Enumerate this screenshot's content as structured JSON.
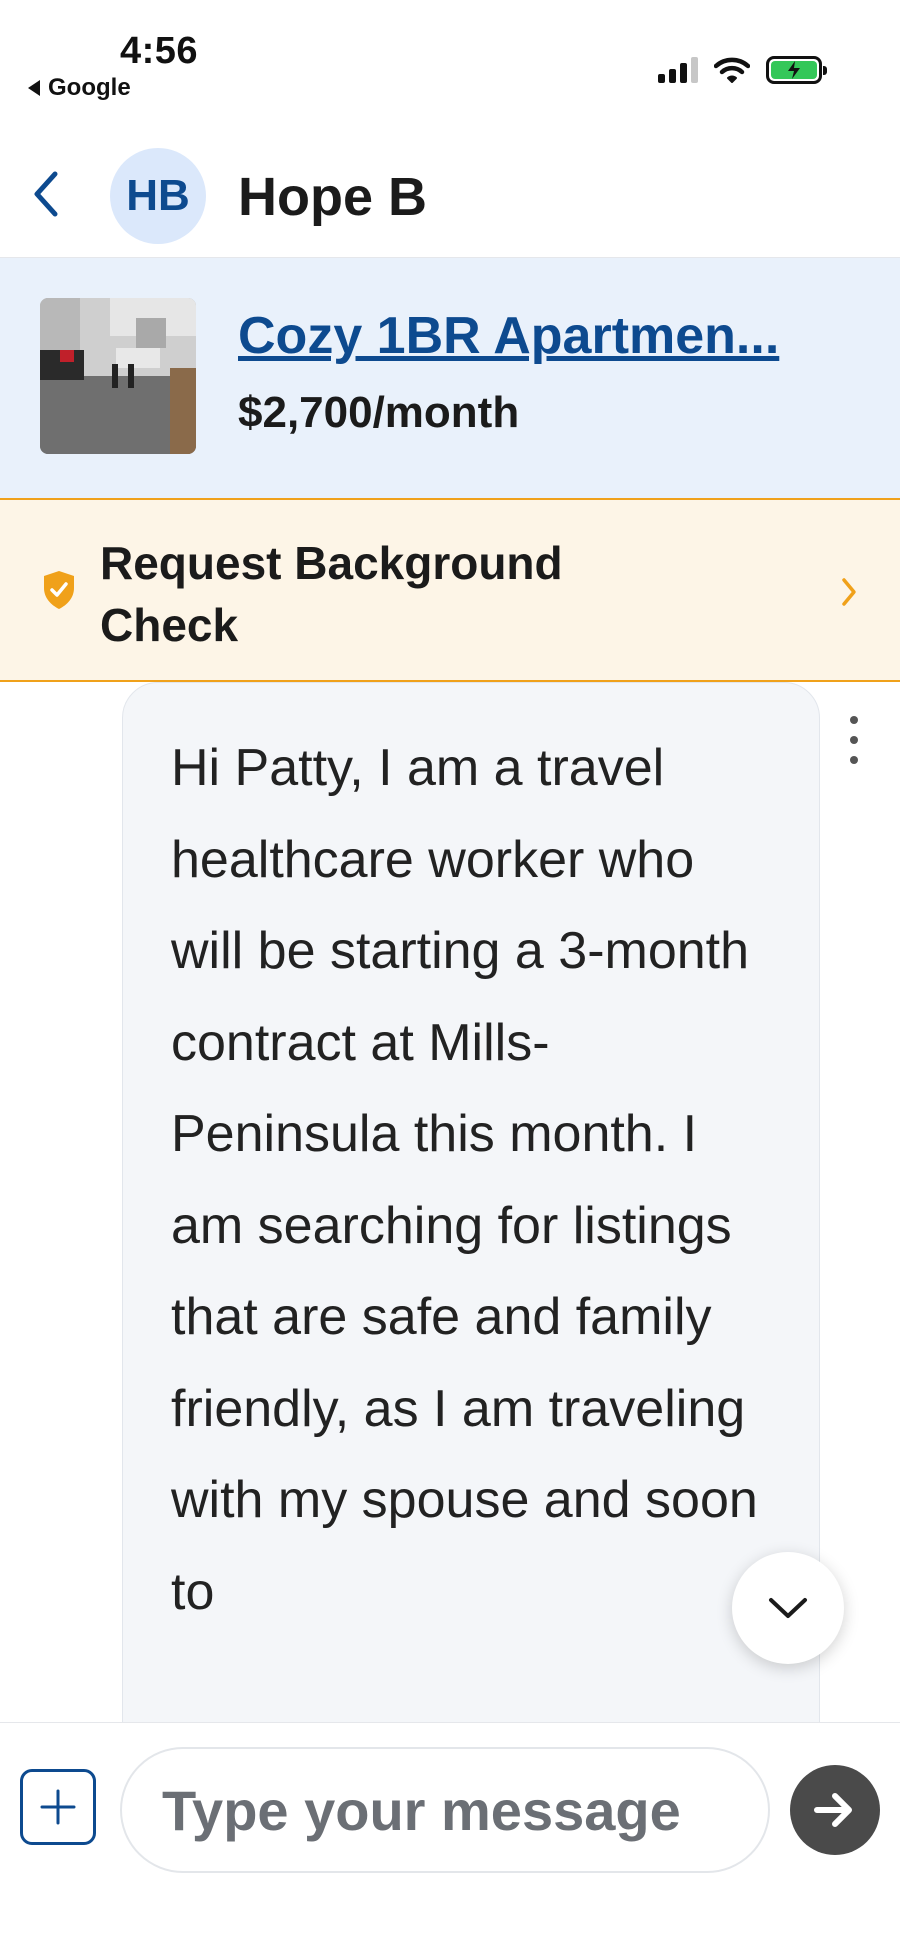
{
  "status_bar": {
    "time": "4:56",
    "back_app": "Google",
    "icons": [
      "cellular-signal-icon",
      "wifi-icon",
      "battery-charging-icon"
    ]
  },
  "header": {
    "avatar_initials": "HB",
    "contact_name": "Hope B"
  },
  "listing": {
    "title": "Cozy 1BR Apartmen...",
    "price": "$2,700/month"
  },
  "background_check": {
    "label": "Request Background Check"
  },
  "message": {
    "text": "Hi Patty, I am a travel healthcare worker who will be starting a 3-month contract at Mills-Peninsula this month. I am searching for listings that are safe and family friendly, as I am traveling with my spouse and soon to"
  },
  "composer": {
    "placeholder": "Type your message"
  },
  "colors": {
    "brand_blue": "#0d4a8f",
    "listing_bg": "#e9f1fb",
    "banner_bg": "#fdf5e7",
    "banner_accent": "#f0a11a",
    "bubble_bg": "#f4f6f9",
    "send_button": "#4a4a4a",
    "battery_green": "#34c759"
  }
}
